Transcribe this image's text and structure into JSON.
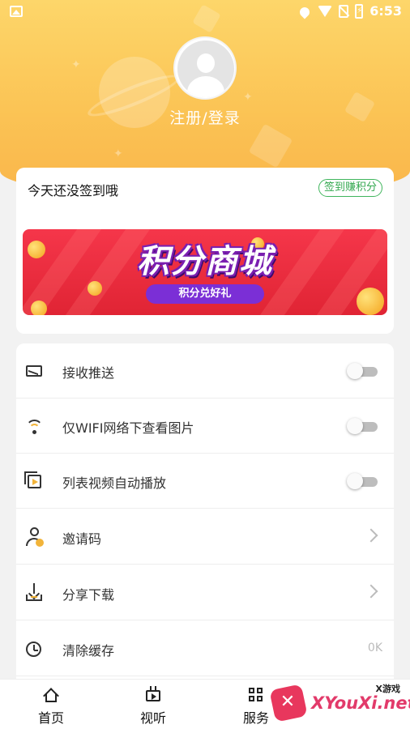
{
  "status_bar": {
    "time": "6:53",
    "icons": [
      "image-icon",
      "location-icon",
      "wifi-icon",
      "no-sim-icon",
      "battery-icon"
    ]
  },
  "profile": {
    "avatar_icon": "default-avatar-icon",
    "login_label": "注册/登录"
  },
  "checkin": {
    "status_text": "今天还没签到哦",
    "button_label": "签到赚积分"
  },
  "banner": {
    "title": "积分商城",
    "subtitle": "积分兑好礼"
  },
  "settings": [
    {
      "icon": "push-mail-icon",
      "label": "接收推送",
      "control": "toggle",
      "on": false
    },
    {
      "icon": "wifi-icon",
      "label": "仅WIFI网络下查看图片",
      "control": "toggle",
      "on": false
    },
    {
      "icon": "video-play-icon",
      "label": "列表视频自动播放",
      "control": "toggle",
      "on": false
    },
    {
      "icon": "add-user-icon",
      "label": "邀请码",
      "control": "chevron"
    },
    {
      "icon": "download-icon",
      "label": "分享下载",
      "control": "chevron"
    },
    {
      "icon": "clear-cache-icon",
      "label": "清除缓存",
      "control": "value",
      "value": "0K"
    }
  ],
  "bottom_nav": [
    {
      "icon": "home-icon",
      "label": "首页"
    },
    {
      "icon": "tv-icon",
      "label": "视听"
    },
    {
      "icon": "grid-icon",
      "label": "服务"
    }
  ],
  "watermark": {
    "text": "XYouXi.net",
    "tag": "X游戏"
  },
  "colors": {
    "header_yellow": "#fbc455",
    "accent_green": "#33a84f",
    "banner_red": "#e02434",
    "banner_purple": "#7b2fd6"
  }
}
